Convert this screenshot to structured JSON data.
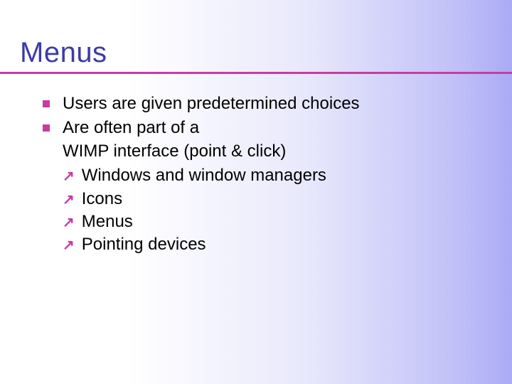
{
  "title": "Menus",
  "bullet1": "Users are given predetermined choices",
  "bullet2_line1": "Are often part of a",
  "bullet2_line2": "WIMP interface (point & click)",
  "sub1": "Windows and window managers",
  "sub2": "Icons",
  "sub3": "Menus",
  "sub4": "Pointing devices"
}
